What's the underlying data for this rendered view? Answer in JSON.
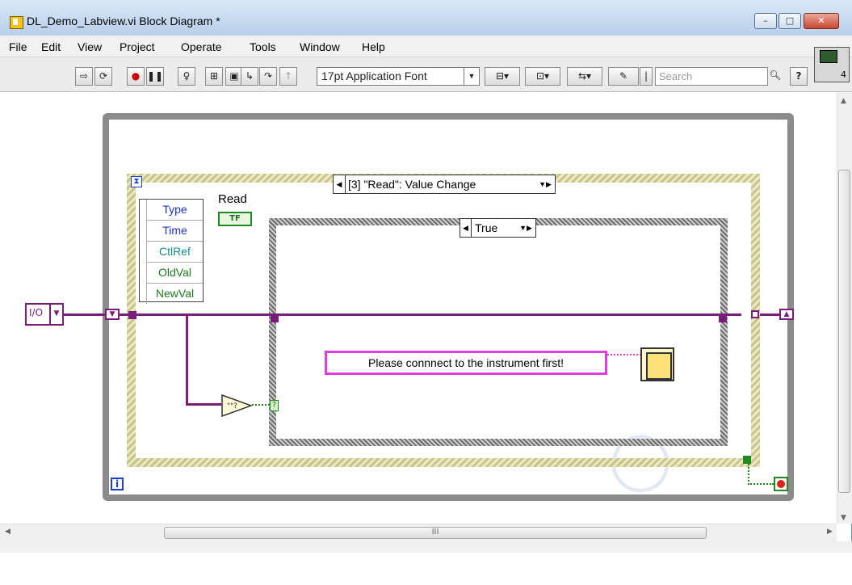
{
  "window": {
    "title": "DL_Demo_Labview.vi Block Diagram *",
    "controls": {
      "minimize": "–",
      "maximize": "□",
      "close": "✕"
    }
  },
  "menu": [
    "File",
    "Edit",
    "View",
    "Project",
    "Operate",
    "Tools",
    "Window",
    "Help"
  ],
  "toolbar": {
    "buttons": [
      "run-arrow-icon",
      "run-continuous-icon",
      "abort-icon",
      "pause-icon",
      "highlight-bulb-icon",
      "retain-wire-icon",
      "step-into-icon",
      "step-over-icon",
      "step-out-icon"
    ],
    "font_label": "17pt Application Font",
    "search_placeholder": "Search",
    "help_label": "?",
    "connector_number": "4"
  },
  "diagram": {
    "event_selector_label": "[3] \"Read\": Value Change",
    "event_data_fields": [
      {
        "label": "Type",
        "color": "#1a32c8"
      },
      {
        "label": "Time",
        "color": "#1a32c8"
      },
      {
        "label": "CtlRef",
        "color": "#1a8a8a"
      },
      {
        "label": "OldVal",
        "color": "#1f7a1f"
      },
      {
        "label": "NewVal",
        "color": "#1f7a1f"
      }
    ],
    "read_terminal_label": "Read",
    "bool_terminal_text": "TF",
    "case_selector_label": "True",
    "message": "Please connnect to the instrument first!",
    "enum_value": "I/O",
    "iteration_label": "i",
    "case_q_label": "?",
    "wire_color": "#7a1c7a",
    "bool_color": "#1f8a1f"
  },
  "scrollbar": {
    "grip": "III"
  }
}
